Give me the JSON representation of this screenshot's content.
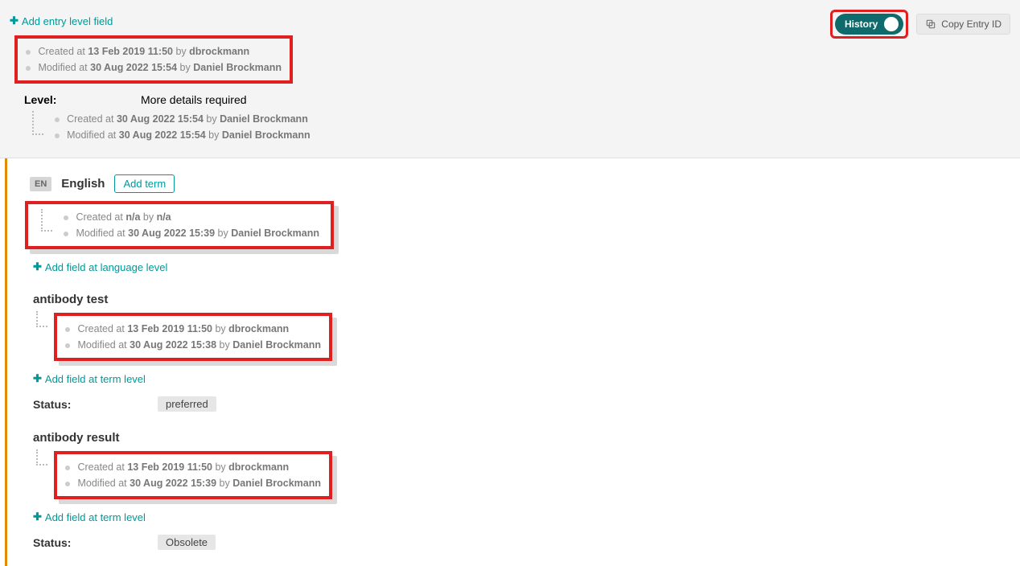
{
  "actions": {
    "add_entry_level_field": "Add entry level field",
    "add_field_language_level": "Add field at language level",
    "add_field_term_level": "Add field at term level",
    "add_term": "Add term",
    "copy_entry_id": "Copy Entry ID",
    "history": "History"
  },
  "entry": {
    "created": {
      "label": "Created at",
      "date": "13 Feb 2019 11:50",
      "by": "by",
      "user": "dbrockmann"
    },
    "modified": {
      "label": "Modified at",
      "date": "30 Aug 2022 15:54",
      "by": "by",
      "user": "Daniel Brockmann"
    },
    "level_label": "Level:",
    "level_value": "More details required",
    "level_meta": {
      "created": {
        "label": "Created at",
        "date": "30 Aug 2022 15:54",
        "by": "by",
        "user": "Daniel Brockmann"
      },
      "modified": {
        "label": "Modified at",
        "date": "30 Aug 2022 15:54",
        "by": "by",
        "user": "Daniel Brockmann"
      }
    }
  },
  "language": {
    "code": "EN",
    "name": "English",
    "created": {
      "label": "Created at",
      "date": "n/a",
      "by": "by",
      "user": "n/a"
    },
    "modified": {
      "label": "Modified at",
      "date": "30 Aug 2022 15:39",
      "by": "by",
      "user": "Daniel Brockmann"
    }
  },
  "terms": [
    {
      "title": "antibody test",
      "created": {
        "label": "Created at",
        "date": "13 Feb 2019 11:50",
        "by": "by",
        "user": "dbrockmann"
      },
      "modified": {
        "label": "Modified at",
        "date": "30 Aug 2022 15:38",
        "by": "by",
        "user": "Daniel Brockmann"
      },
      "status_label": "Status:",
      "status_value": "preferred"
    },
    {
      "title": "antibody result",
      "created": {
        "label": "Created at",
        "date": "13 Feb 2019 11:50",
        "by": "by",
        "user": "dbrockmann"
      },
      "modified": {
        "label": "Modified at",
        "date": "30 Aug 2022 15:39",
        "by": "by",
        "user": "Daniel Brockmann"
      },
      "status_label": "Status:",
      "status_value": "Obsolete"
    }
  ]
}
